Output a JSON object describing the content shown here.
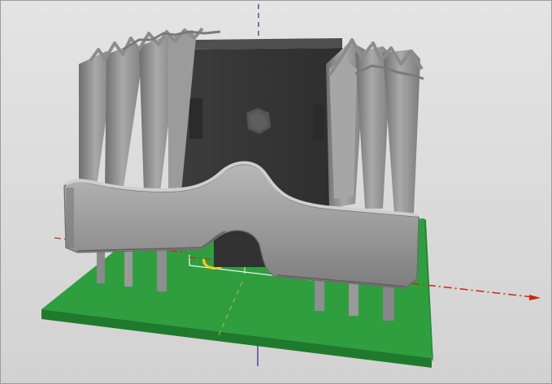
{
  "viewport": {
    "background_top": "#e3e3e3",
    "background_bottom": "#d2d2d2"
  },
  "axes": {
    "x_axis_color": "#d0250f",
    "y_axis_color": "#7a8a3a",
    "z_axis_color": "#2a2a8c"
  },
  "colors": {
    "pcb": "#2f9e3f",
    "pcb_dark": "#1e7a2c",
    "pcb_silkscreen": "#f2f2f2",
    "component_body": "#3a3a3a",
    "component_face": "#4a4a4a",
    "heatsink": "#8f8f8f",
    "heatsink_light": "#b4b4b4",
    "heatsink_dark": "#6c6c6c",
    "pad_marker": "#f2d21e"
  },
  "icons": {
    "axis_triad": "axis-lines",
    "screw": "hex-screw-icon"
  }
}
